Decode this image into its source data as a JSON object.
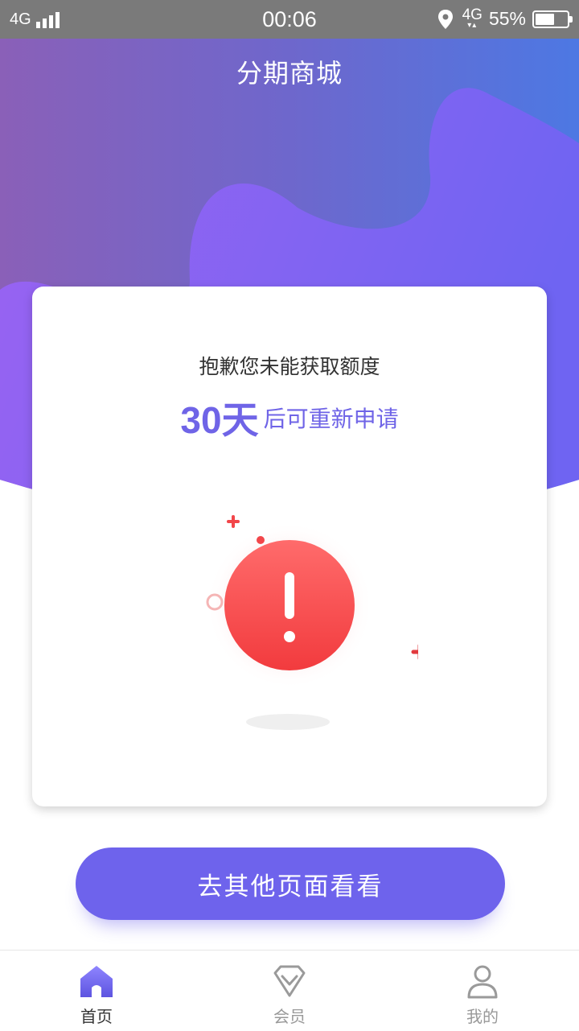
{
  "status_bar": {
    "network_left": "4G",
    "time": "00:06",
    "network_right": "4G",
    "battery": "55%"
  },
  "header": {
    "title": "分期商城"
  },
  "result": {
    "message": "抱歉您未能获取额度",
    "days": "30天",
    "days_suffix": "后可重新申请"
  },
  "cta": {
    "label": "去其他页面看看"
  },
  "tabbar": {
    "items": [
      {
        "label": "首页",
        "icon": "home-icon",
        "active": true
      },
      {
        "label": "会员",
        "icon": "diamond-icon",
        "active": false
      },
      {
        "label": "我的",
        "icon": "user-icon",
        "active": false
      }
    ]
  },
  "colors": {
    "accent": "#6e63ec",
    "error": "#f5484b",
    "header_purple": "#8e63b8",
    "header_blue": "#4f76e3"
  }
}
